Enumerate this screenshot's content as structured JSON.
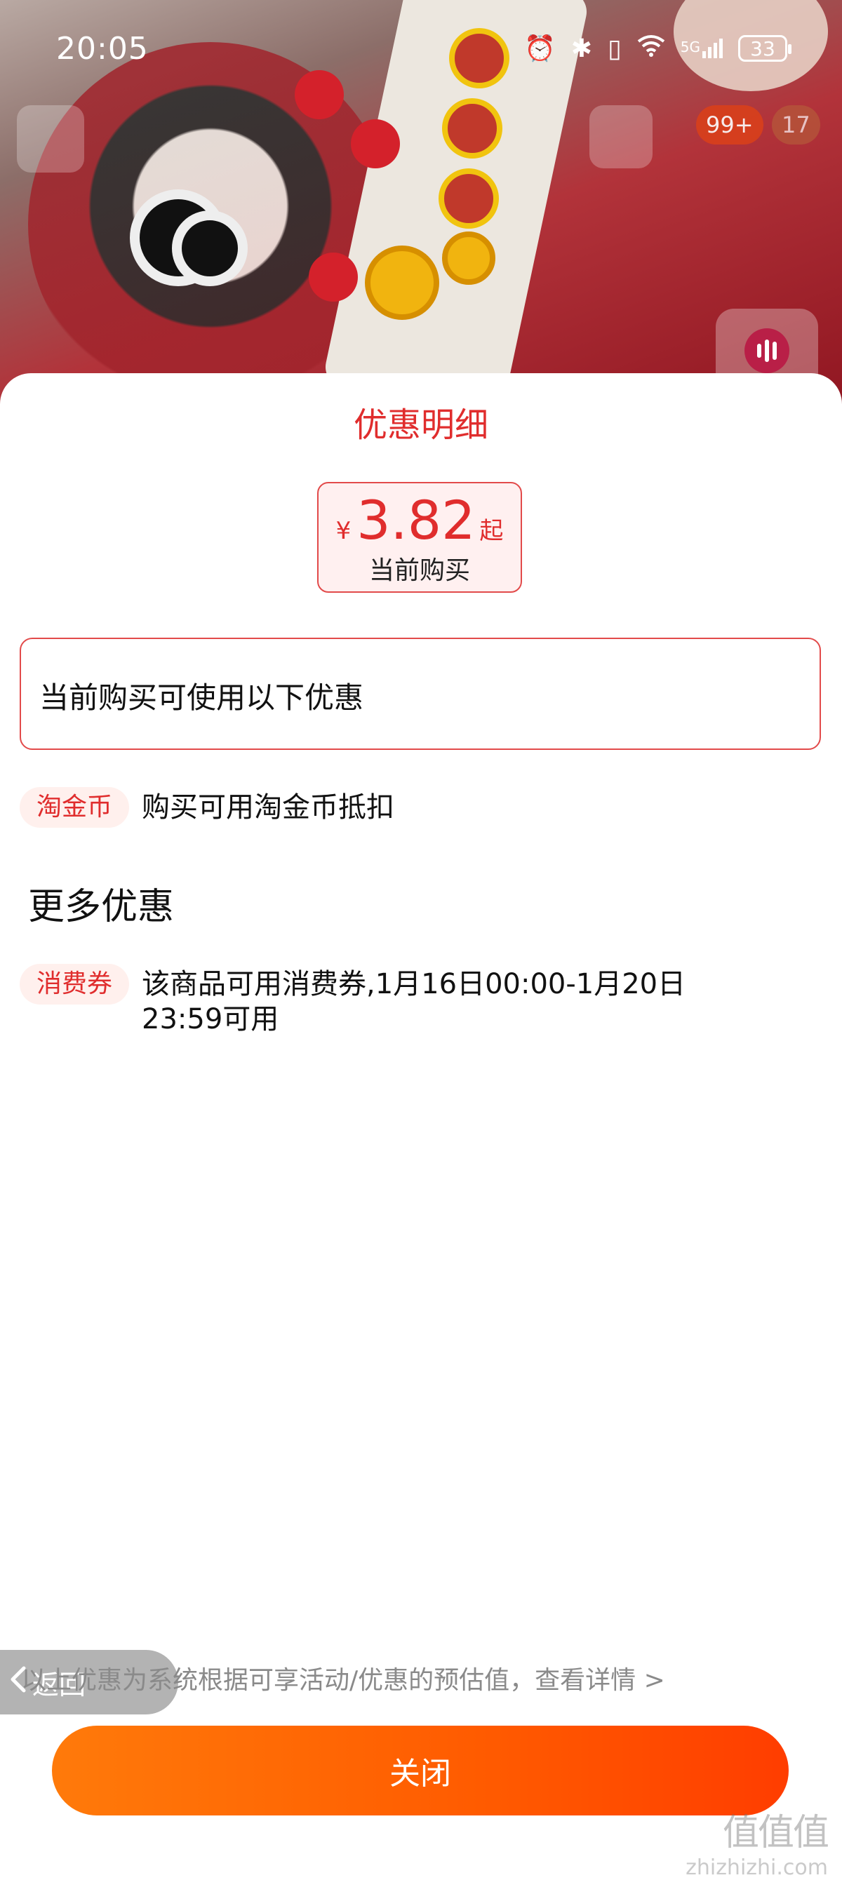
{
  "status_bar": {
    "time": "20:05",
    "network": "5G",
    "battery": "33"
  },
  "overlay": {
    "cart_badge": "99+",
    "count_badge": "17"
  },
  "sheet": {
    "title": "优惠明细",
    "price": {
      "currency": "¥",
      "amount": "3.82",
      "suffix": "起",
      "label": "当前购买"
    },
    "info_text": "当前购买可使用以下优惠",
    "items": [
      {
        "tag": "淘金币",
        "text": "购买可用淘金币抵扣"
      }
    ],
    "more_title": "更多优惠",
    "more_items": [
      {
        "tag": "消费券",
        "text": "该商品可用消费券,1月16日00:00-1月20日23:59可用"
      }
    ],
    "back_label": "返回",
    "disclaimer": "以上优惠为系统根据可享活动/优惠的预估值，查看详情 >",
    "close_label": "关闭"
  },
  "watermark": {
    "logo": "值值值",
    "site": "zhizhizhi.com"
  },
  "colors": {
    "accent": "#e02d2d",
    "button_start": "#ff7a0a",
    "button_end": "#ff3d00",
    "tag_bg": "#fff0ed"
  }
}
